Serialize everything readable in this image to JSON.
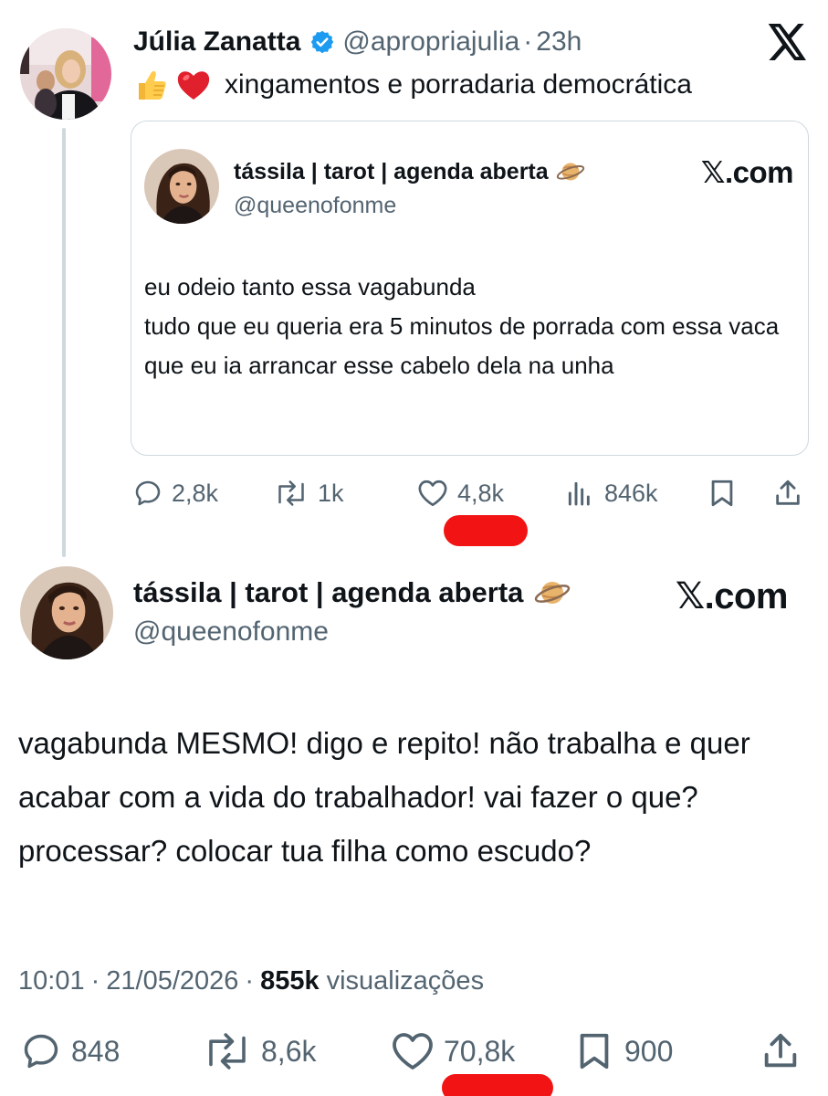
{
  "platform": {
    "logo": "x-logo-icon"
  },
  "top_tweet": {
    "author_name": "Júlia Zanatta",
    "verified": true,
    "handle": "@apropriajulia",
    "separator": "·",
    "time": "23h",
    "emojis": [
      "thumbs-up-icon",
      "red-heart-icon"
    ],
    "text": "xingamentos e porradaria democrática",
    "quoted": {
      "author_name": "tássila | tarot | agenda aberta",
      "badge_emoji": "ringed-planet-icon",
      "handle": "@queenofonme",
      "source": "𝕏.com",
      "body": "eu odeio tanto essa vagabunda\ntudo que eu queria era 5 minutos de porrada com essa vaca que eu ia arrancar esse cabelo dela na unha"
    },
    "actions": {
      "replies": "2,8k",
      "reposts": "1k",
      "likes": "4,8k",
      "views": "846k"
    }
  },
  "main_tweet": {
    "author_name": "tássila | tarot | agenda aberta",
    "badge_emoji": "ringed-planet-icon",
    "handle": "@queenofonme",
    "source": "𝕏.com",
    "body": "vagabunda MESMO! digo e repito! não trabalha e quer acabar com a vida do trabalhador! vai fazer o que? processar? colocar tua filha como escudo?",
    "time": "10:01",
    "separator": "·",
    "date": "21/05/2026",
    "views_count": "855k",
    "views_label": "visualizações",
    "actions": {
      "replies": "848",
      "reposts": "8,6k",
      "likes": "70,8k",
      "bookmarks": "900"
    }
  },
  "colors": {
    "text": "#0f1419",
    "secondary": "#536471",
    "border": "#cfd9de",
    "verified": "#1d9bf0",
    "redaction": "#f21414"
  }
}
